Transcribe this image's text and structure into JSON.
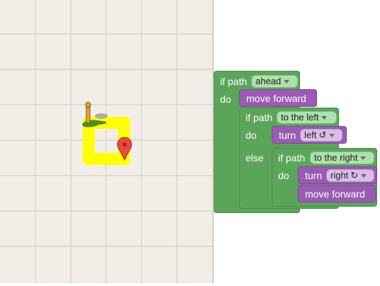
{
  "blocks": {
    "outer_if": {
      "keyword_if_path": "if path",
      "keyword_do": "do",
      "direction": "ahead"
    },
    "move_forward_1": {
      "label": "move forward"
    },
    "inner_if_else": {
      "keyword_if_path": "if path",
      "keyword_do": "do",
      "keyword_else": "else",
      "direction": "to the left"
    },
    "turn_left": {
      "label": "turn",
      "direction": "left",
      "rotate_icon": "↺"
    },
    "nested_if": {
      "keyword_if_path": "if path",
      "keyword_do": "do",
      "direction": "to the right"
    },
    "turn_right": {
      "label": "turn",
      "direction": "right",
      "rotate_icon": "↻"
    },
    "move_forward_2": {
      "label": "move forward"
    }
  },
  "colors": {
    "logic_block": "#5ba55b",
    "movement_block": "#9a5bb4",
    "path": "#ffff00",
    "maze_bg": "#f1eee7",
    "grid_line": "#d4cfc4",
    "marker": "#e84a3c"
  },
  "icons": {
    "pegman": "pegman-icon",
    "goal": "goal-marker-icon"
  }
}
